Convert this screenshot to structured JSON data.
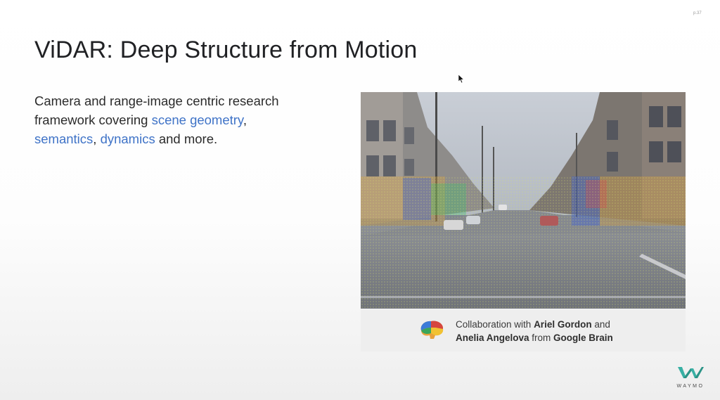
{
  "slide": {
    "number": "p.37",
    "title": "ViDAR: Deep Structure from Motion",
    "body": {
      "part1": "Camera and range-image centric research framework covering ",
      "link1": "scene geometry",
      "part2": ",",
      "link2": "semantics",
      "part3": ", ",
      "link3": "dynamics",
      "part4": " and more."
    },
    "caption": {
      "prefix": "Collaboration with ",
      "name1": "Ariel Gordon",
      "mid": " and",
      "name2": "Anelia Angelova",
      "mid2": " from ",
      "org": "Google Brain"
    },
    "logo_text": "WAYMO",
    "accent_color": "#3f73c7",
    "icons": [
      "brain-icon",
      "cursor-icon",
      "waymo-logo-icon"
    ]
  }
}
